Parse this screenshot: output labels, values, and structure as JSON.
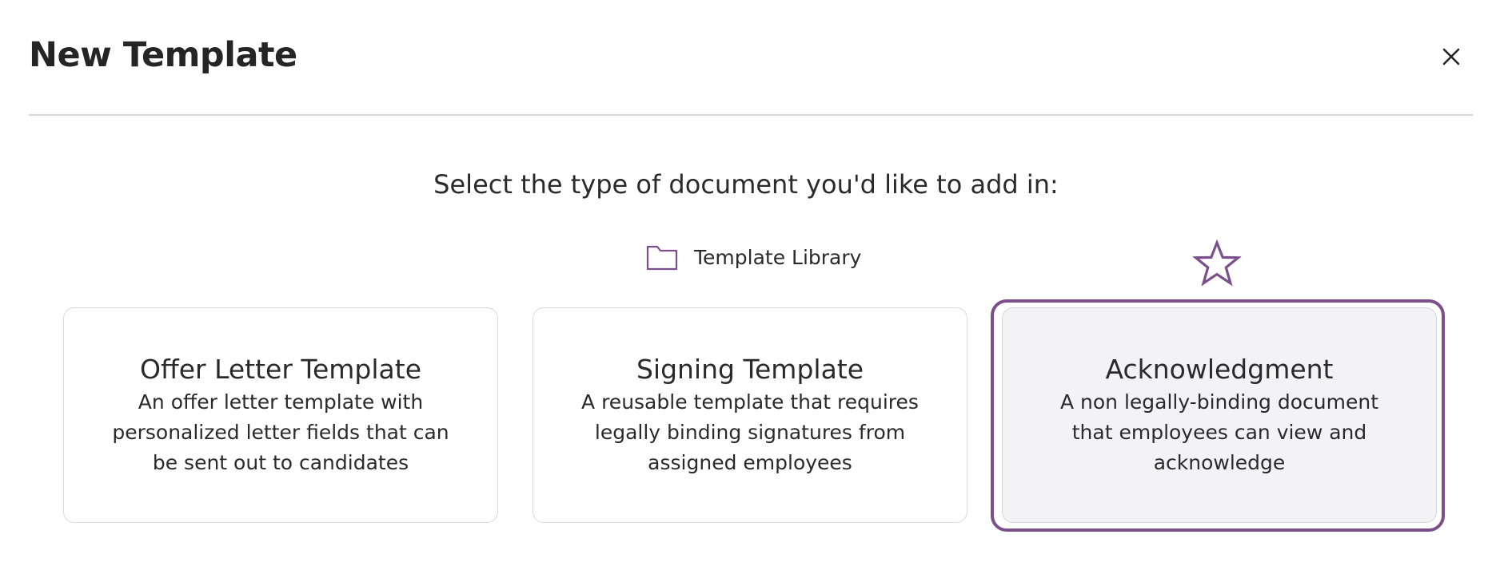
{
  "dialog": {
    "title": "New Template",
    "close_icon": "close-icon"
  },
  "prompt": "Select the type of document you'd like to add in:",
  "library": {
    "icon": "folder-icon",
    "label": "Template Library"
  },
  "recommended_icon": "star-icon",
  "cards": [
    {
      "title": "Offer Letter Template",
      "description": "An offer letter template with personalized letter fields that can be sent out to candidates",
      "selected": false
    },
    {
      "title": "Signing Template",
      "description": "A reusable template that requires legally binding signatures from assigned employees",
      "selected": false
    },
    {
      "title": "Acknowledgment",
      "description": "A non legally-binding document that employees can view and acknowledge",
      "selected": true
    }
  ],
  "colors": {
    "accent": "#7b4e8c",
    "text": "#252525",
    "divider": "#d6d6d6",
    "selected_card_bg": "#f3f3f5"
  }
}
